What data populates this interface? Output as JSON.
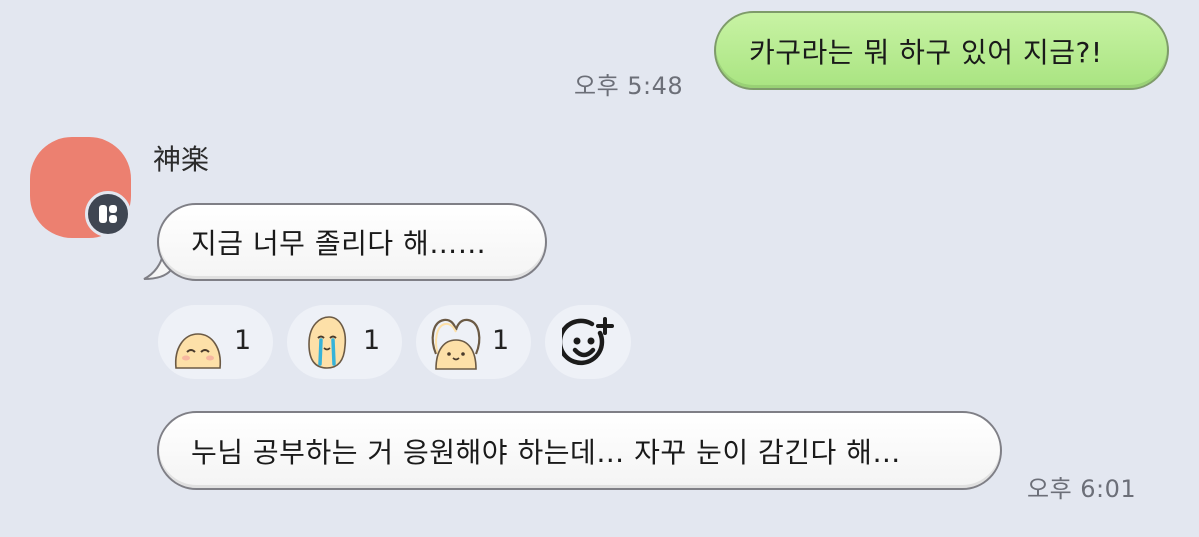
{
  "messages": {
    "outgoing_text": "카구라는 뭐 하구 있어 지금?!",
    "outgoing_time": "오후 5:48",
    "sender_name": "神楽",
    "incoming_1_text": "지금 너무 졸리다 해……",
    "incoming_2_text": "누님 공부하는 거 응원해야 하는데… 자꾸 눈이 감긴다 해…",
    "incoming_2_time": "오후 6:01"
  },
  "reactions": [
    {
      "icon": "smiling-potato-icon",
      "count": "1"
    },
    {
      "icon": "crying-potato-icon",
      "count": "1"
    },
    {
      "icon": "heart-arms-potato-icon",
      "count": "1"
    },
    {
      "icon": "add-reaction-icon"
    }
  ],
  "colors": {
    "background": "#e3e7f0",
    "outgoing_bubble": "#b6ea8d",
    "avatar": "#ec8070"
  }
}
